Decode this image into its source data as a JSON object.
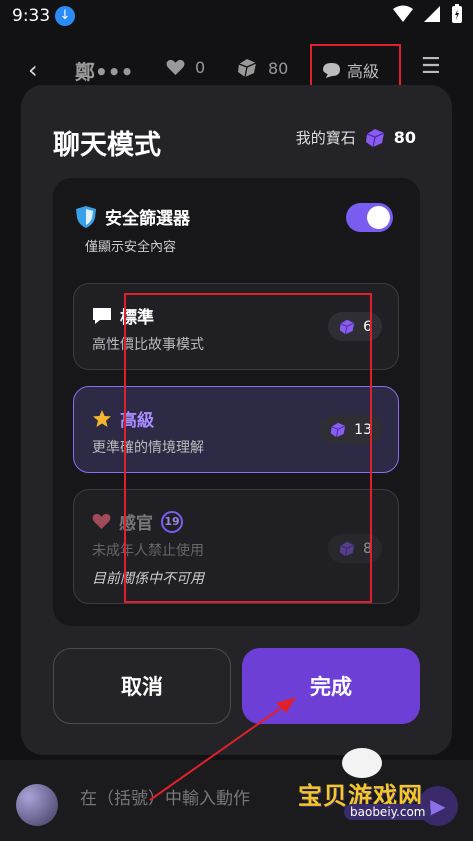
{
  "status_bar": {
    "time": "9:33"
  },
  "top_bar": {
    "character_name": "鄭•••",
    "likes": "0",
    "gems": "80",
    "mode_label": "高級"
  },
  "modal": {
    "title": "聊天模式",
    "my_gems_label": "我的寶石",
    "my_gems_count": "80",
    "safe_filter": {
      "title": "安全篩選器",
      "description": "僅顯示安全內容",
      "enabled": true
    },
    "options": [
      {
        "label": "標準",
        "description": "高性價比故事模式",
        "cost": "6",
        "icon": "speech-bubble-icon",
        "state": "normal"
      },
      {
        "label": "高級",
        "description": "更準確的情境理解",
        "cost": "13",
        "icon": "star-icon",
        "state": "selected"
      },
      {
        "label": "感官",
        "age_badge": "19",
        "description": "未成年人禁止使用",
        "note": "目前關係中不可用",
        "cost": "8",
        "icon": "heart-icon",
        "state": "disabled"
      }
    ],
    "cancel_label": "取消",
    "done_label": "完成"
  },
  "input_bar": {
    "placeholder": "在（括號）中輸入動作"
  },
  "watermark": {
    "text": "宝贝游戏网",
    "url": "baobeiy.com"
  },
  "colors": {
    "accent": "#6d3fd6",
    "toggle": "#7b5cf0",
    "annotation_red": "#e0202c",
    "star": "#f5b52e",
    "heart": "#d06a7a"
  }
}
